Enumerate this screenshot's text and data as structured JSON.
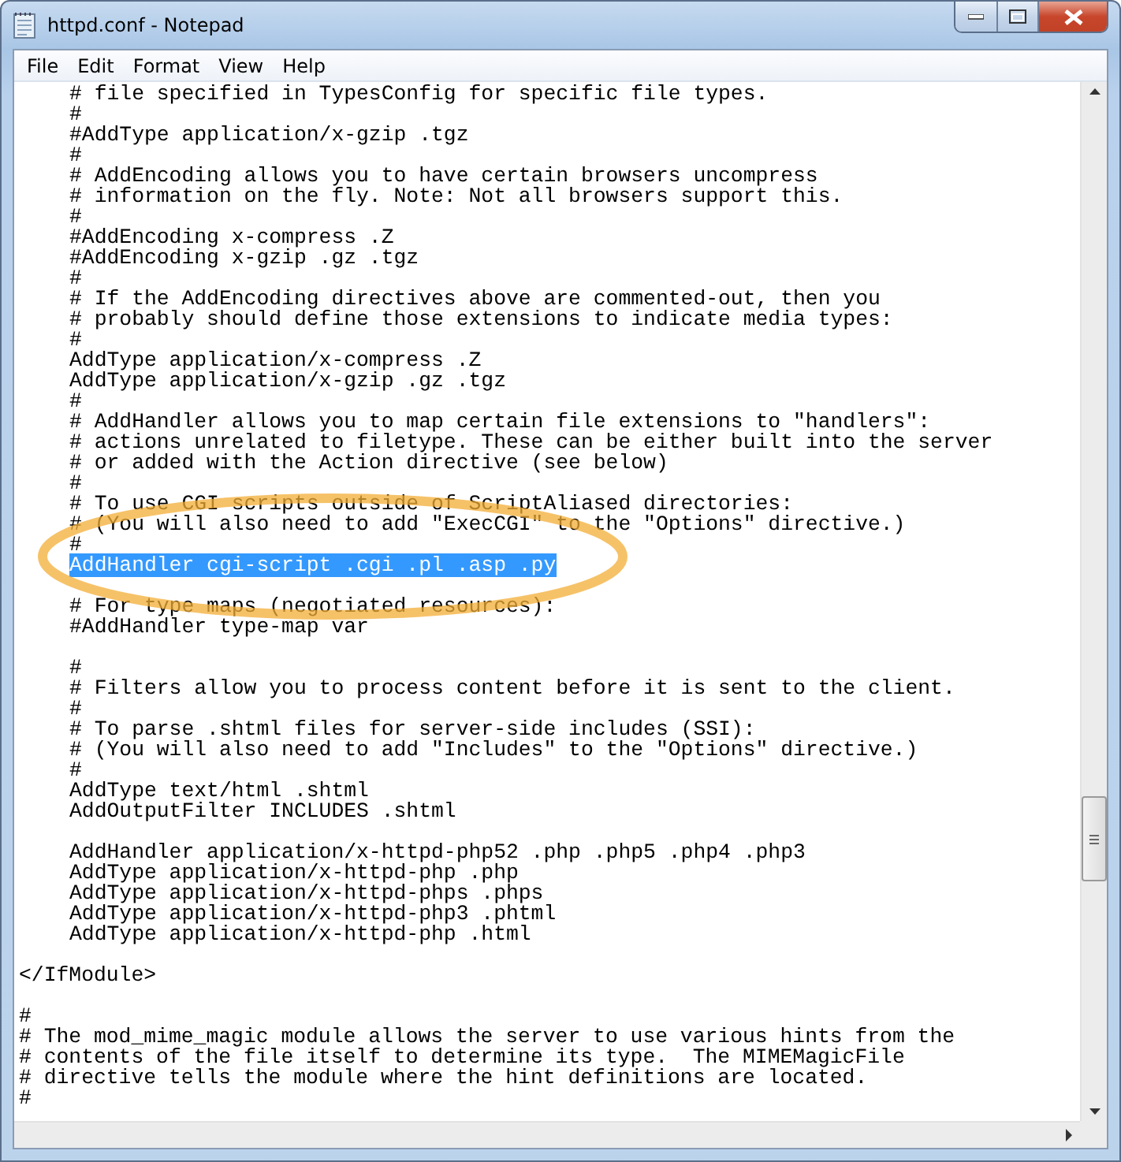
{
  "window": {
    "title": "httpd.conf - Notepad"
  },
  "menu": [
    {
      "label": "File"
    },
    {
      "label": "Edit"
    },
    {
      "label": "Format"
    },
    {
      "label": "View"
    },
    {
      "label": "Help"
    }
  ],
  "lines": [
    {
      "kind": "text",
      "indented": true,
      "selected": false,
      "text": "# file specified in TypesConfig for specific file types."
    },
    {
      "kind": "text",
      "indented": true,
      "selected": false,
      "text": "#"
    },
    {
      "kind": "text",
      "indented": true,
      "selected": false,
      "text": "#AddType application/x-gzip .tgz"
    },
    {
      "kind": "text",
      "indented": true,
      "selected": false,
      "text": "#"
    },
    {
      "kind": "text",
      "indented": true,
      "selected": false,
      "text": "# AddEncoding allows you to have certain browsers uncompress"
    },
    {
      "kind": "text",
      "indented": true,
      "selected": false,
      "text": "# information on the fly. Note: Not all browsers support this."
    },
    {
      "kind": "text",
      "indented": true,
      "selected": false,
      "text": "#"
    },
    {
      "kind": "text",
      "indented": true,
      "selected": false,
      "text": "#AddEncoding x-compress .Z"
    },
    {
      "kind": "text",
      "indented": true,
      "selected": false,
      "text": "#AddEncoding x-gzip .gz .tgz"
    },
    {
      "kind": "text",
      "indented": true,
      "selected": false,
      "text": "#"
    },
    {
      "kind": "text",
      "indented": true,
      "selected": false,
      "text": "# If the AddEncoding directives above are commented-out, then you"
    },
    {
      "kind": "text",
      "indented": true,
      "selected": false,
      "text": "# probably should define those extensions to indicate media types:"
    },
    {
      "kind": "text",
      "indented": true,
      "selected": false,
      "text": "#"
    },
    {
      "kind": "text",
      "indented": true,
      "selected": false,
      "text": "AddType application/x-compress .Z"
    },
    {
      "kind": "text",
      "indented": true,
      "selected": false,
      "text": "AddType application/x-gzip .gz .tgz"
    },
    {
      "kind": "text",
      "indented": true,
      "selected": false,
      "text": "#"
    },
    {
      "kind": "text",
      "indented": true,
      "selected": false,
      "text": "# AddHandler allows you to map certain file extensions to \"handlers\":"
    },
    {
      "kind": "text",
      "indented": true,
      "selected": false,
      "text": "# actions unrelated to filetype. These can be either built into the server"
    },
    {
      "kind": "text",
      "indented": true,
      "selected": false,
      "text": "# or added with the Action directive (see below)"
    },
    {
      "kind": "text",
      "indented": true,
      "selected": false,
      "text": "#"
    },
    {
      "kind": "text",
      "indented": true,
      "selected": false,
      "text": "# To use CGI scripts outside of ScriptAliased directories:"
    },
    {
      "kind": "text",
      "indented": true,
      "selected": false,
      "text": "# (You will also need to add \"ExecCGI\" to the \"Options\" directive.)"
    },
    {
      "kind": "text",
      "indented": true,
      "selected": false,
      "text": "#"
    },
    {
      "kind": "text",
      "indented": true,
      "selected": true,
      "text": "AddHandler cgi-script .cgi .pl .asp .py"
    },
    {
      "kind": "blank"
    },
    {
      "kind": "text",
      "indented": true,
      "selected": false,
      "text": "# For type maps (negotiated resources):"
    },
    {
      "kind": "text",
      "indented": true,
      "selected": false,
      "text": "#AddHandler type-map var"
    },
    {
      "kind": "blank"
    },
    {
      "kind": "text",
      "indented": true,
      "selected": false,
      "text": "#"
    },
    {
      "kind": "text",
      "indented": true,
      "selected": false,
      "text": "# Filters allow you to process content before it is sent to the client."
    },
    {
      "kind": "text",
      "indented": true,
      "selected": false,
      "text": "#"
    },
    {
      "kind": "text",
      "indented": true,
      "selected": false,
      "text": "# To parse .shtml files for server-side includes (SSI):"
    },
    {
      "kind": "text",
      "indented": true,
      "selected": false,
      "text": "# (You will also need to add \"Includes\" to the \"Options\" directive.)"
    },
    {
      "kind": "text",
      "indented": true,
      "selected": false,
      "text": "#"
    },
    {
      "kind": "text",
      "indented": true,
      "selected": false,
      "text": "AddType text/html .shtml"
    },
    {
      "kind": "text",
      "indented": true,
      "selected": false,
      "text": "AddOutputFilter INCLUDES .shtml"
    },
    {
      "kind": "blank"
    },
    {
      "kind": "text",
      "indented": true,
      "selected": false,
      "text": "AddHandler application/x-httpd-php52 .php .php5 .php4 .php3"
    },
    {
      "kind": "text",
      "indented": true,
      "selected": false,
      "text": "AddType application/x-httpd-php .php"
    },
    {
      "kind": "text",
      "indented": true,
      "selected": false,
      "text": "AddType application/x-httpd-phps .phps"
    },
    {
      "kind": "text",
      "indented": true,
      "selected": false,
      "text": "AddType application/x-httpd-php3 .phtml"
    },
    {
      "kind": "text",
      "indented": true,
      "selected": false,
      "text": "AddType application/x-httpd-php .html"
    },
    {
      "kind": "blank"
    },
    {
      "kind": "text",
      "indented": false,
      "selected": false,
      "text": "</IfModule>"
    },
    {
      "kind": "blank"
    },
    {
      "kind": "text",
      "indented": false,
      "selected": false,
      "text": "#"
    },
    {
      "kind": "text",
      "indented": false,
      "selected": false,
      "text": "# The mod_mime_magic module allows the server to use various hints from the"
    },
    {
      "kind": "text",
      "indented": false,
      "selected": false,
      "text": "# contents of the file itself to determine its type.  The MIMEMagicFile"
    },
    {
      "kind": "text",
      "indented": false,
      "selected": false,
      "text": "# directive tells the module where the hint definitions are located."
    },
    {
      "kind": "text",
      "indented": false,
      "selected": false,
      "text": "#"
    }
  ],
  "annotations": [
    {
      "kind": "ellipse"
    }
  ]
}
